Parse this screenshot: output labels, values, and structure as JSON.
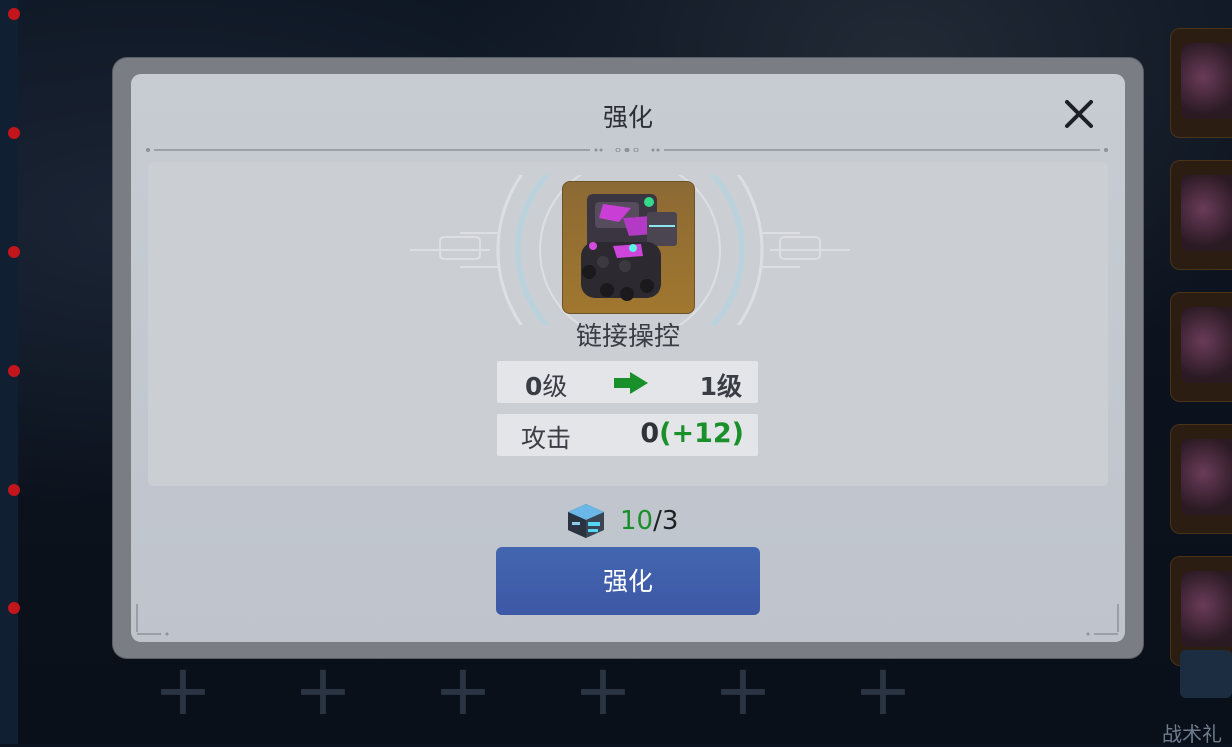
{
  "dialog": {
    "title": "强化",
    "close_icon": "close-icon"
  },
  "item": {
    "name": "链接操控",
    "icon": "mech-module-icon"
  },
  "level": {
    "from_value": "0",
    "from_unit": "级",
    "to": "1级"
  },
  "stat": {
    "label": "攻击",
    "value": "0",
    "bonus": "(+12)"
  },
  "cost": {
    "icon": "material-cube-icon",
    "have": "10",
    "separator": "/",
    "need": "3"
  },
  "upgrade_button": {
    "label": "强化"
  },
  "background": {
    "gift_label": "战术礼"
  },
  "colors": {
    "accent_green": "#19902a",
    "button_blue": "#4366b0",
    "item_frame": "#a1772f"
  }
}
